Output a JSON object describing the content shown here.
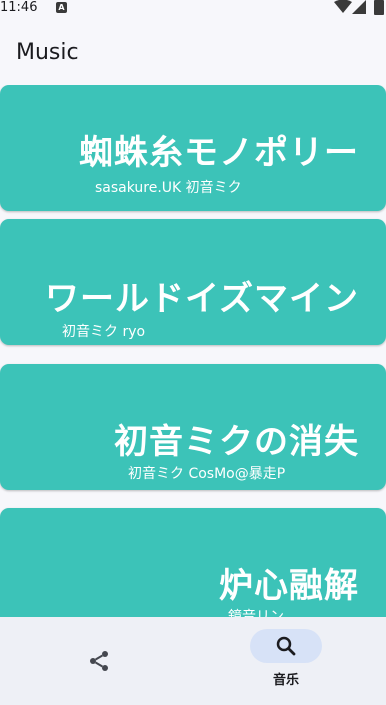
{
  "status_bar": {
    "time": "11:46",
    "badge": "A"
  },
  "app_bar": {
    "title": "Music"
  },
  "songs": [
    {
      "title": "蜘蛛糸モノポリー",
      "artist": "sasakure.UK 初音ミク"
    },
    {
      "title": "ワールドイズマイン",
      "artist": "初音ミク ryo"
    },
    {
      "title": "初音ミクの消失",
      "artist": "初音ミク CosMo@暴走P"
    },
    {
      "title": "炉心融解",
      "artist": "鏡音リン"
    }
  ],
  "bottom_nav": {
    "share": {
      "icon": "share-icon"
    },
    "music": {
      "icon": "search-icon",
      "label": "音乐",
      "selected": true
    }
  },
  "colors": {
    "card": "#3cc3b8",
    "nav_pill": "#d7e2f7",
    "nav_bg": "#eef0f6",
    "background": "#f7f7fb"
  }
}
